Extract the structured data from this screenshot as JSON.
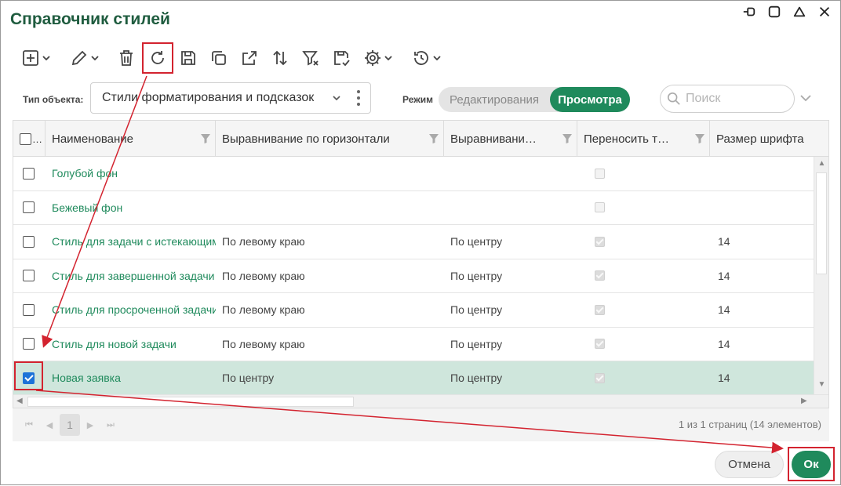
{
  "dialog": {
    "title": "Справочник стилей"
  },
  "window_controls": [
    "pin-icon",
    "maximize-icon",
    "collapse-icon",
    "close-icon"
  ],
  "toolbar": {
    "buttons": [
      {
        "icon": "add-icon",
        "dropdown": true
      },
      {
        "icon": "edit-pencil-icon",
        "dropdown": true
      },
      {
        "icon": "delete-icon"
      },
      {
        "icon": "refresh-icon",
        "highlighted": true
      },
      {
        "icon": "save-icon"
      },
      {
        "icon": "copy-icon"
      },
      {
        "icon": "export-icon"
      },
      {
        "icon": "sort-icon"
      },
      {
        "icon": "clear-filter-icon"
      },
      {
        "icon": "save-check-icon"
      },
      {
        "icon": "settings-icon",
        "dropdown": true
      },
      {
        "icon": "history-icon",
        "dropdown": true
      }
    ]
  },
  "filter": {
    "object_type_label": "Тип объекта:",
    "object_type_value": "Стили форматирования и подсказок",
    "mode_label": "Режим",
    "mode_options": [
      "Редактирования",
      "Просмотра"
    ],
    "mode_active": "Просмотра",
    "search_placeholder": "Поиск"
  },
  "table": {
    "columns": [
      "Наименование",
      "Выравнивание по горизонтали",
      "Выравнивани…",
      "Переносить т…",
      "Размер шрифта"
    ],
    "header_checkbox_label": "…",
    "rows": [
      {
        "name": "Голубой фон",
        "h_align": "",
        "v_align": "",
        "wrap": false,
        "font_size": "",
        "selected": false
      },
      {
        "name": "Бежевый фон",
        "h_align": "",
        "v_align": "",
        "wrap": false,
        "font_size": "",
        "selected": false
      },
      {
        "name": "Стиль для задачи с истекающим",
        "h_align": "По левому краю",
        "v_align": "По центру",
        "wrap": true,
        "font_size": "14",
        "selected": false
      },
      {
        "name": "Стиль для завершенной задачи",
        "h_align": "По левому краю",
        "v_align": "По центру",
        "wrap": true,
        "font_size": "14",
        "selected": false
      },
      {
        "name": "Стиль для просроченной задачи",
        "h_align": "По левому краю",
        "v_align": "По центру",
        "wrap": true,
        "font_size": "14",
        "selected": false
      },
      {
        "name": "Стиль для новой задачи",
        "h_align": "По левому краю",
        "v_align": "По центру",
        "wrap": true,
        "font_size": "14",
        "selected": false
      },
      {
        "name": "Новая заявка",
        "h_align": "По центру",
        "v_align": "По центру",
        "wrap": true,
        "font_size": "14",
        "selected": true
      }
    ]
  },
  "pager": {
    "current_page": "1",
    "info": "1 из 1 страниц (14 элементов)"
  },
  "footer": {
    "cancel_label": "Отмена",
    "ok_label": "Ок"
  },
  "colors": {
    "accent": "#1f8a5c",
    "title": "#1f5c3f",
    "annotation": "#d3232f",
    "selected_row": "#cfe6dc"
  }
}
